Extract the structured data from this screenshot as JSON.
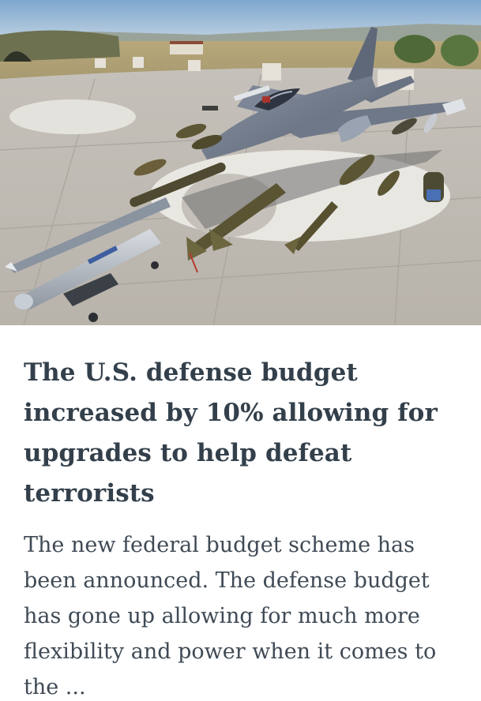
{
  "article": {
    "title": "The U.S. defense budget increased by 10% allowing for upgrades to help defeat terrorists",
    "excerpt": "The new federal budget scheme has been announced. The defense budget has gone up allowing for much more flexibility and power when it comes to the ..."
  },
  "hero_image": {
    "subject": "fighter-jet-with-munitions-on-tarmac"
  },
  "colors": {
    "title_text": "#33404b",
    "body_text": "#3f4a55",
    "background": "#ffffff"
  }
}
